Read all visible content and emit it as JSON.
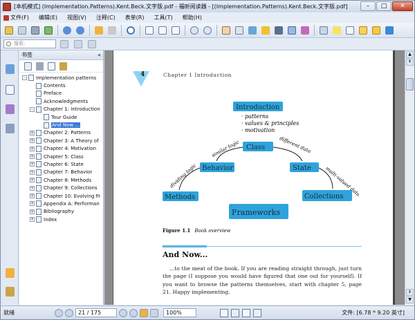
{
  "window": {
    "title": "[本机模式] (Implementation.Patterns).Kent.Beck.文字版.pdf - 福昕阅读器 - [(Implementation.Patterns).Kent.Beck.文字版.pdf]",
    "min": "–",
    "max": "□",
    "close": "✕"
  },
  "menu": [
    {
      "label": "文件(F)"
    },
    {
      "label": "编辑(E)"
    },
    {
      "label": "视图(V)"
    },
    {
      "label": "注释(C)"
    },
    {
      "label": "表单(R)"
    },
    {
      "label": "工具(T)"
    },
    {
      "label": "帮助(H)"
    }
  ],
  "toolbar": {
    "search_placeholder": "搜索:"
  },
  "panel": {
    "title": "书签",
    "pin": "«",
    "tree": [
      {
        "label": "Implementation patterns",
        "level": 0,
        "toggle": "-"
      },
      {
        "label": "Contents",
        "level": 1,
        "toggle": ""
      },
      {
        "label": "Preface",
        "level": 1,
        "toggle": ""
      },
      {
        "label": "Acknowledgments",
        "level": 1,
        "toggle": ""
      },
      {
        "label": "Chapter 1: Introduction",
        "level": 1,
        "toggle": "-"
      },
      {
        "label": "Tour Guide",
        "level": 2,
        "toggle": ""
      },
      {
        "label": "And Now ...",
        "level": 2,
        "toggle": "",
        "selected": true
      },
      {
        "label": "Chapter 2: Patterns",
        "level": 1,
        "toggle": "+"
      },
      {
        "label": "Chapter 3: A Theory of",
        "level": 1,
        "toggle": "+"
      },
      {
        "label": "Chapter 4: Motivation",
        "level": 1,
        "toggle": "+"
      },
      {
        "label": "Chapter 5: Class",
        "level": 1,
        "toggle": "+"
      },
      {
        "label": "Chapter 6: State",
        "level": 1,
        "toggle": "+"
      },
      {
        "label": "Chapter 7: Behavior",
        "level": 1,
        "toggle": "+"
      },
      {
        "label": "Chapter 8: Methods",
        "level": 1,
        "toggle": "+"
      },
      {
        "label": "Chapter 9: Collections",
        "level": 1,
        "toggle": "+"
      },
      {
        "label": "Chapter 10: Evolving Fr",
        "level": 1,
        "toggle": "+"
      },
      {
        "label": "Appendix A: Performan",
        "level": 1,
        "toggle": "+"
      },
      {
        "label": "Bibliography",
        "level": 1,
        "toggle": "+"
      },
      {
        "label": "Index",
        "level": 1,
        "toggle": "+"
      }
    ]
  },
  "page": {
    "number": "4",
    "running_head": "Chapter 1   Introduction",
    "diagram": {
      "introduction": "Introduction",
      "bullets": [
        "· patterns",
        "· values & principles",
        "· motivation"
      ],
      "class": "Class",
      "behavior": "Behavior",
      "state": "State",
      "methods": "Methods",
      "collections": "Collections",
      "frameworks": "Frameworks",
      "similar_logic": "similar logic",
      "different_data": "different data",
      "dividing_logic": "dividing logic",
      "multi_valued_data": "multi-valued data"
    },
    "caption_label": "Figure 1.1",
    "caption_text": "Book overview",
    "heading": "And Now...",
    "paragraph": "...to the meat of the book. If you are reading straight through, just turn the page (I suppose you would have figured that one out for yourself). If you want to browse the patterns themselves, start with chapter 5, page 21. Happy implementing."
  },
  "status": {
    "left": "就绪",
    "page_field": "21 / 175",
    "zoom": "100%",
    "size": "文件: [6.78 * 9.20 英寸]"
  },
  "colors": {
    "accent_blue": "#2ea3db",
    "selection": "#3a78d8"
  }
}
